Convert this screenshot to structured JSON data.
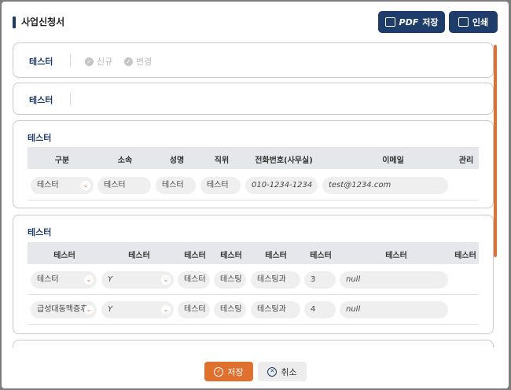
{
  "header": {
    "title": "사업신청서",
    "pdf_prefix": "PDF",
    "pdf_label": "저장",
    "print_label": "인쇄"
  },
  "card1": {
    "label": "테스터",
    "options": [
      "신규",
      "변경"
    ]
  },
  "card2": {
    "label": "테스터"
  },
  "card3": {
    "label": "테스터",
    "columns": [
      "구분",
      "소속",
      "성명",
      "직위",
      "전화번호(사무실)",
      "이메일",
      "관리"
    ],
    "row": {
      "type": "테스터",
      "org": "테스터",
      "name": "테스터",
      "position": "테스터",
      "phone": "010-1234-1234",
      "email": "test@1234.com"
    }
  },
  "card4": {
    "label": "테스터",
    "columns": [
      "테스터",
      "테스터",
      "테스터",
      "테스터",
      "테스터",
      "테스터",
      "테스터",
      "테스터"
    ],
    "rows": [
      {
        "c1": "테스터",
        "c2": "Y",
        "c3": "테스터",
        "c4": "테스팅",
        "c5": "테스팅과",
        "c6": "3",
        "c7": "null"
      },
      {
        "c1": "급성대동맥증후",
        "c2": "Y",
        "c3": "테스터",
        "c4": "테스팅",
        "c5": "테스팅과",
        "c6": "4",
        "c7": "null"
      }
    ]
  },
  "footer": {
    "save_label": "저장",
    "cancel_label": "취소"
  },
  "colors": {
    "primary": "#1f3d6b",
    "accent": "#e0702e"
  }
}
